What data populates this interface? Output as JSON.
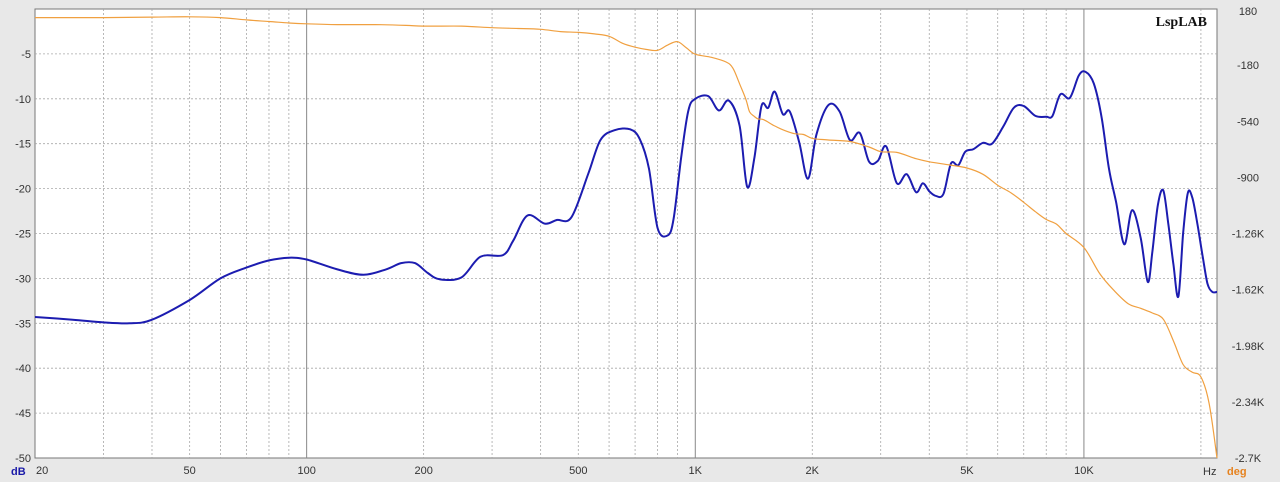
{
  "chart_data": {
    "type": "line",
    "brand": "LspLAB",
    "x_scale": "log",
    "xlim": [
      20,
      22000
    ],
    "ylim": [
      -50,
      0
    ],
    "y2lim": [
      -2700,
      180
    ],
    "grid": true,
    "x_tick_labels": [
      {
        "value": 20,
        "label": "20"
      },
      {
        "value": 50,
        "label": "50"
      },
      {
        "value": 100,
        "label": "100"
      },
      {
        "value": 200,
        "label": "200"
      },
      {
        "value": 500,
        "label": "500"
      },
      {
        "value": 1000,
        "label": "1K"
      },
      {
        "value": 2000,
        "label": "2K"
      },
      {
        "value": 5000,
        "label": "5K"
      },
      {
        "value": 10000,
        "label": "10K"
      }
    ],
    "x_unit": "Hz",
    "y_unit": "dB",
    "y2_unit": "deg",
    "y_ticks": [
      "-5",
      "-10",
      "-15",
      "-20",
      "-25",
      "-30",
      "-35",
      "-40",
      "-45",
      "-50"
    ],
    "y_tick_values": [
      -5,
      -10,
      -15,
      -20,
      -25,
      -30,
      -35,
      -40,
      -45,
      -50
    ],
    "y2_ticks": [
      "180",
      "-180",
      "-540",
      "-900",
      "-1.26K",
      "-1.62K",
      "-1.98K",
      "-2.34K",
      "-2.7K"
    ],
    "y2_tick_values": [
      180,
      -180,
      -540,
      -900,
      -1260,
      -1620,
      -1980,
      -2340,
      -2700
    ],
    "colors": {
      "magnitude": "#1c1cb0",
      "phase": "#f0a040",
      "plot_bg": "#ffffff",
      "grid": "#a8a8a8",
      "decade_grid": "#888888"
    },
    "series": [
      {
        "axis": "left",
        "x": [
          20,
          25,
          30,
          35,
          40,
          50,
          60,
          70,
          80,
          90,
          100,
          120,
          140,
          160,
          175,
          190,
          205,
          220,
          250,
          280,
          320,
          340,
          370,
          410,
          440,
          480,
          530,
          570,
          620,
          680,
          720,
          760,
          800,
          850,
          880,
          920,
          960,
          1000,
          1080,
          1150,
          1220,
          1300,
          1360,
          1420,
          1480,
          1540,
          1600,
          1680,
          1750,
          1850,
          1950,
          2050,
          2200,
          2350,
          2500,
          2650,
          2800,
          2950,
          3100,
          3300,
          3500,
          3700,
          3850,
          4000,
          4150,
          4350,
          4550,
          4750,
          4950,
          5200,
          5500,
          5800,
          6200,
          6600,
          7000,
          7500,
          8000,
          8300,
          8700,
          9200,
          9700,
          10100,
          10600,
          11100,
          11600,
          12100,
          12700,
          13300,
          14000,
          14600,
          15000,
          15500,
          16000,
          16500,
          17000,
          17500,
          18000,
          18500,
          19000,
          19600,
          20200,
          20800,
          21400,
          22000
        ],
        "y": [
          -34.3,
          -34.6,
          -34.9,
          -35.0,
          -34.6,
          -32.4,
          -30.0,
          -28.8,
          -28.0,
          -27.7,
          -27.9,
          -29.0,
          -29.6,
          -29.0,
          -28.3,
          -28.3,
          -29.4,
          -30.1,
          -29.9,
          -27.6,
          -27.4,
          -25.8,
          -23.0,
          -23.9,
          -23.5,
          -23.2,
          -18.4,
          -14.6,
          -13.5,
          -13.4,
          -14.5,
          -17.8,
          -24.4,
          -25.2,
          -23.3,
          -16.5,
          -11.3,
          -10.0,
          -9.7,
          -11.3,
          -10.2,
          -13.0,
          -19.8,
          -16.5,
          -10.8,
          -11.0,
          -9.2,
          -11.7,
          -11.4,
          -14.8,
          -18.9,
          -14.0,
          -10.7,
          -11.4,
          -14.6,
          -13.8,
          -17.0,
          -16.9,
          -15.3,
          -19.4,
          -18.4,
          -20.4,
          -19.4,
          -20.3,
          -20.8,
          -20.6,
          -17.2,
          -17.4,
          -15.9,
          -15.6,
          -14.9,
          -15.0,
          -13.1,
          -11.0,
          -10.8,
          -11.9,
          -12.0,
          -11.9,
          -9.5,
          -9.9,
          -7.4,
          -7.0,
          -8.3,
          -12.0,
          -17.8,
          -21.5,
          -26.2,
          -22.4,
          -25.5,
          -30.4,
          -27.0,
          -21.8,
          -20.2,
          -24.0,
          -28.5,
          -32.0,
          -25.0,
          -20.5,
          -21.0,
          -24.0,
          -27.5,
          -30.6,
          -31.5,
          -31.5
        ],
        "name": ""
      },
      {
        "axis": "right",
        "x": [
          20,
          30,
          40,
          50,
          60,
          70,
          80,
          90,
          100,
          120,
          150,
          180,
          200,
          250,
          300,
          350,
          400,
          450,
          500,
          550,
          600,
          650,
          700,
          750,
          800,
          850,
          900,
          950,
          1000,
          1100,
          1200,
          1250,
          1300,
          1350,
          1380,
          1420,
          1450,
          1500,
          1600,
          1700,
          1800,
          1900,
          2000,
          2200,
          2500,
          2800,
          3000,
          3300,
          3700,
          4000,
          4500,
          5000,
          5500,
          6000,
          6500,
          7000,
          7500,
          8000,
          8500,
          9000,
          10000,
          11000,
          12000,
          13000,
          14000,
          15000,
          16000,
          17000,
          18000,
          19000,
          20000,
          21000,
          22000
        ],
        "y": [
          125,
          125,
          128,
          130,
          125,
          110,
          100,
          90,
          85,
          80,
          80,
          75,
          70,
          70,
          60,
          55,
          50,
          35,
          30,
          20,
          5,
          -40,
          -65,
          -80,
          -85,
          -50,
          -30,
          -70,
          -110,
          -130,
          -160,
          -200,
          -300,
          -400,
          -480,
          -510,
          -525,
          -530,
          -570,
          -600,
          -620,
          -625,
          -650,
          -660,
          -670,
          -705,
          -735,
          -740,
          -780,
          -800,
          -820,
          -840,
          -880,
          -950,
          -1000,
          -1060,
          -1120,
          -1170,
          -1200,
          -1260,
          -1350,
          -1520,
          -1630,
          -1710,
          -1740,
          -1770,
          -1810,
          -1950,
          -2100,
          -2150,
          -2180,
          -2350,
          -2700
        ],
        "name": ""
      }
    ]
  }
}
